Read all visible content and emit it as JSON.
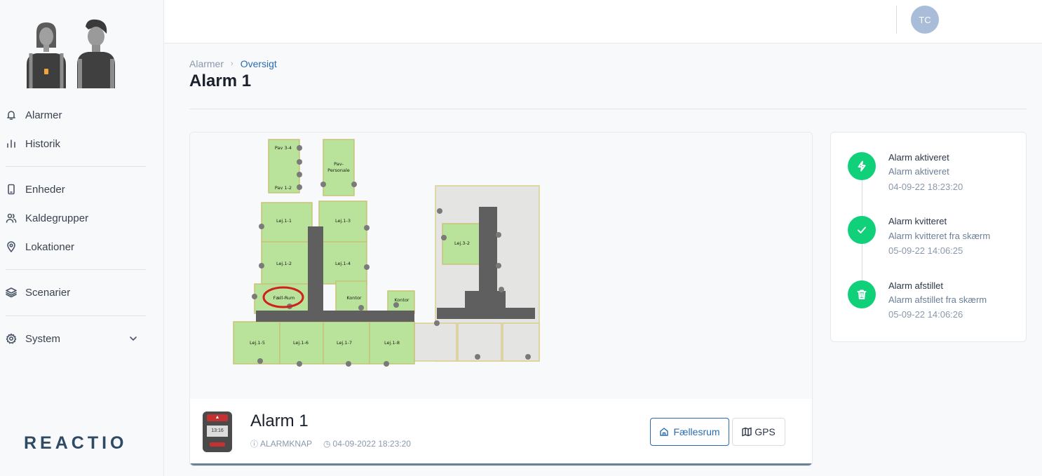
{
  "sidebar": {
    "items": [
      {
        "label": "Alarmer",
        "icon": "bell-icon"
      },
      {
        "label": "Historik",
        "icon": "bar-chart-icon"
      },
      {
        "label": "Enheder",
        "icon": "device-icon"
      },
      {
        "label": "Kaldegrupper",
        "icon": "users-icon"
      },
      {
        "label": "Lokationer",
        "icon": "map-pin-icon"
      },
      {
        "label": "Scenarier",
        "icon": "layers-icon"
      },
      {
        "label": "System",
        "icon": "gear-icon"
      }
    ],
    "logo_text": "REACTIO"
  },
  "topbar": {
    "avatar_initials": "TC"
  },
  "breadcrumb": {
    "parent": "Alarmer",
    "current": "Oversigt"
  },
  "page_title": "Alarm 1",
  "map": {
    "rooms": {
      "pav34": "Pav 3-4",
      "pav12": "Pav 1-2",
      "pavpers1": "Pav-",
      "pavpers2": "Personale",
      "lej11": "Lej.1-1",
      "lej13": "Lej.1-3",
      "lej12": "Lej.1-2",
      "lej14": "Lej.1-4",
      "fallrum": "Fæll-Rum",
      "kontor1": "Kontor",
      "kontor2": "Kontor",
      "lej15": "Lej.1-5",
      "lej16": "Lej.1-6",
      "lej17": "Lej.1-7",
      "lej18": "Lej.1-8",
      "lej32": "Lej.3-2"
    },
    "highlight_color": "#d0211c"
  },
  "alarm": {
    "title": "Alarm 1",
    "type": "ALARMKNAP",
    "timestamp": "04-09-2022 18:23:20",
    "device_screen": "13:16",
    "location_button": "Fællesrum",
    "gps_button": "GPS"
  },
  "timeline": [
    {
      "title": "Alarm aktiveret",
      "desc": "Alarm aktiveret",
      "time": "04-09-22 18:23:20",
      "icon": "lightning-icon"
    },
    {
      "title": "Alarm kvitteret",
      "desc": "Alarm kvitteret fra skærm",
      "time": "05-09-22 14:06:25",
      "icon": "check-icon"
    },
    {
      "title": "Alarm afstillet",
      "desc": "Alarm afstillet fra skærm",
      "time": "05-09-22 14:06:26",
      "icon": "trash-icon"
    }
  ],
  "colors": {
    "accent": "#2b6cb0",
    "success": "#10d07a",
    "room": "#b9e39a",
    "corridor": "#606060"
  }
}
